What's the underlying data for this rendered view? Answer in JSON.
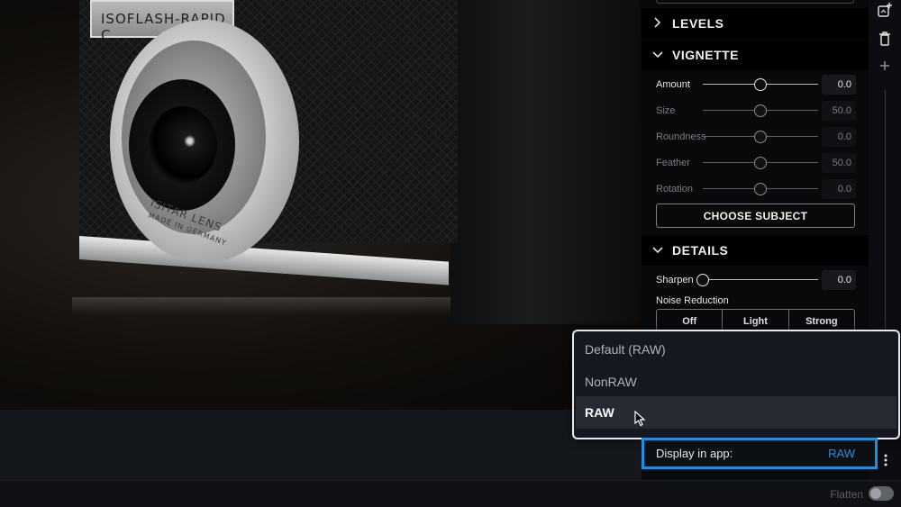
{
  "photo": {
    "camera_plate_text": "ISOFLASH-RAPID C",
    "lens_text": "ISITAR LENS",
    "lens_subtext": "MADE IN GERMANY"
  },
  "panel": {
    "levels": {
      "title": "LEVELS",
      "expanded": false
    },
    "vignette": {
      "title": "VIGNETTE",
      "expanded": true,
      "sliders": [
        {
          "label": "Amount",
          "value": "0.0",
          "position": 0.5,
          "enabled": true
        },
        {
          "label": "Size",
          "value": "50.0",
          "position": 0.5,
          "enabled": false
        },
        {
          "label": "Roundness",
          "value": "0.0",
          "position": 0.5,
          "enabled": false
        },
        {
          "label": "Feather",
          "value": "50.0",
          "position": 0.5,
          "enabled": false
        },
        {
          "label": "Rotation",
          "value": "0.0",
          "position": 0.5,
          "enabled": false
        }
      ],
      "choose_subject_label": "CHOOSE SUBJECT"
    },
    "details": {
      "title": "DETAILS",
      "expanded": true,
      "sharpen": {
        "label": "Sharpen",
        "value": "0.0",
        "position": 0.0
      },
      "noise_reduction": {
        "label": "Noise Reduction",
        "options": [
          "Off",
          "Light",
          "Strong"
        ]
      }
    }
  },
  "dropdown": {
    "options": [
      "Default (RAW)",
      "NonRAW",
      "RAW"
    ],
    "highlighted": "RAW"
  },
  "display_in_app": {
    "label": "Display in app:",
    "value": "RAW",
    "accent_color": "#1e8fe0"
  },
  "bottom_bar": {
    "flatten_label": "Flatten",
    "flatten_on": false
  },
  "icons": [
    "add-image-icon",
    "trash-icon",
    "plus-icon",
    "kebab-menu-icon",
    "chevron-right-icon",
    "chevron-down-icon"
  ]
}
